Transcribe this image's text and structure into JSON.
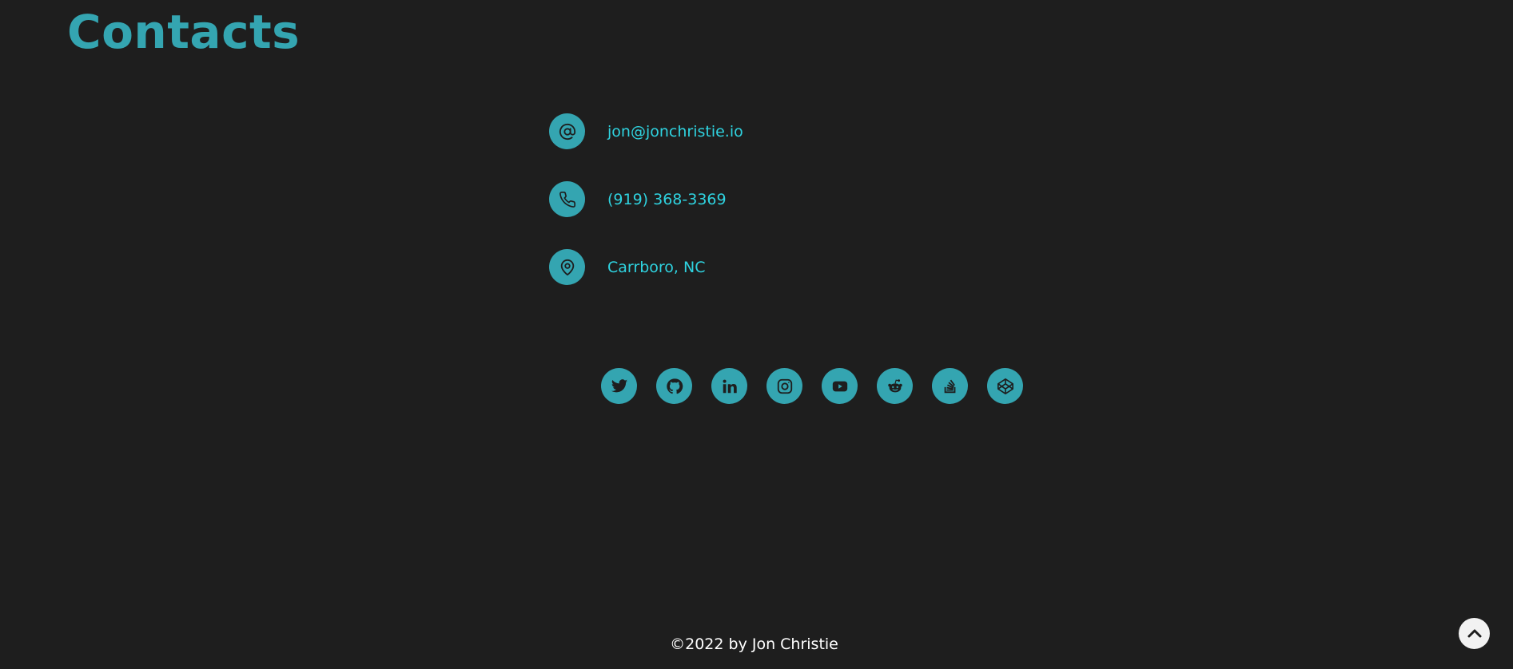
{
  "heading": "Contacts",
  "contacts": {
    "email": {
      "icon": "at-icon",
      "text": "jon@jonchristie.io"
    },
    "phone": {
      "icon": "phone-icon",
      "text": "(919) 368-3369"
    },
    "location": {
      "icon": "map-pin-icon",
      "text": "Carrboro, NC"
    }
  },
  "social": [
    {
      "icon": "twitter-icon"
    },
    {
      "icon": "github-icon"
    },
    {
      "icon": "linkedin-icon"
    },
    {
      "icon": "instagram-icon"
    },
    {
      "icon": "youtube-icon"
    },
    {
      "icon": "reddit-icon"
    },
    {
      "icon": "stackoverflow-icon"
    },
    {
      "icon": "codepen-icon"
    }
  ],
  "footer": "©2022 by Jon Christie",
  "back_to_top": {
    "icon": "chevron-up-icon"
  },
  "colors": {
    "background": "#1e1e1e",
    "accent": "#34a5b1",
    "link": "#2fd3e0",
    "footer_text": "#ffffff",
    "icon_fg": "#1e1e1e"
  }
}
